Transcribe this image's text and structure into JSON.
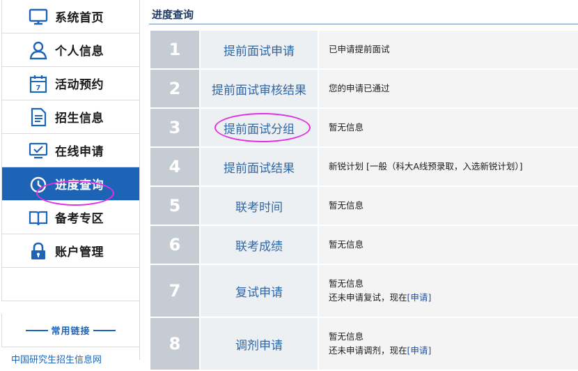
{
  "sidebar": {
    "items": [
      {
        "label": "系统首页",
        "icon": "monitor-icon"
      },
      {
        "label": "个人信息",
        "icon": "user-icon"
      },
      {
        "label": "活动预约",
        "icon": "calendar-icon"
      },
      {
        "label": "招生信息",
        "icon": "document-icon"
      },
      {
        "label": "在线申请",
        "icon": "online-apply-icon"
      },
      {
        "label": "进度查询",
        "icon": "clock-icon",
        "active": true
      },
      {
        "label": "备考专区",
        "icon": "book-icon"
      },
      {
        "label": "账户管理",
        "icon": "lock-icon"
      }
    ],
    "links_title": "常用链接",
    "first_link": "中国研究生招生信息网"
  },
  "main": {
    "title": "进度查询",
    "rows": [
      {
        "num": "1",
        "step": "提前面试申请",
        "status": "已申请提前面试"
      },
      {
        "num": "2",
        "step": "提前面试审核结果",
        "status": "您的申请已通过"
      },
      {
        "num": "3",
        "step": "提前面试分组",
        "status": "暂无信息"
      },
      {
        "num": "4",
        "step": "提前面试结果",
        "status": "新锐计划 [一般（科大A线预录取，入选新锐计划）]"
      },
      {
        "num": "5",
        "step": "联考时间",
        "status": "暂无信息"
      },
      {
        "num": "6",
        "step": "联考成绩",
        "status": "暂无信息"
      },
      {
        "num": "7",
        "step": "复试申请",
        "status": "暂无信息",
        "status2": "还未申请复试，现在",
        "link": "[申请]"
      },
      {
        "num": "8",
        "step": "调剂申请",
        "status": "暂无信息",
        "status2": "还未申请调剂，现在",
        "link": "[申请]"
      }
    ]
  },
  "colors": {
    "accent": "#1e64b6",
    "number_cell": "#c5ccd4",
    "step_text": "#2f66a6",
    "annotation": "#e22fe4"
  }
}
